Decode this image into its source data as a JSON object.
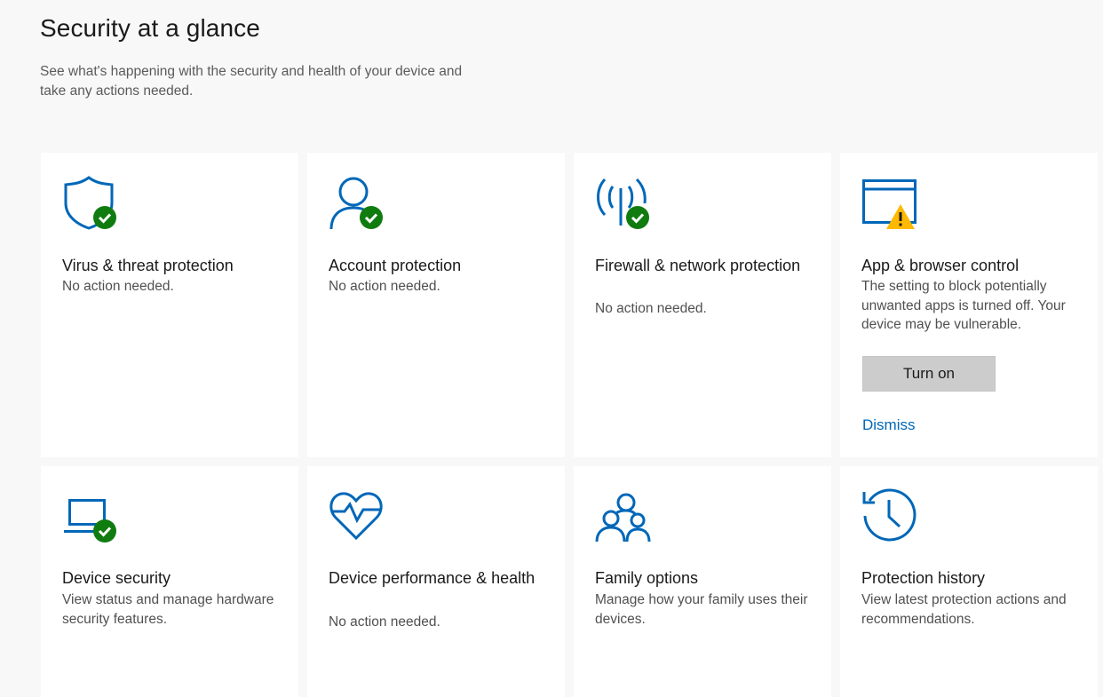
{
  "header": {
    "title": "Security at a glance",
    "subtitle": "See what's happening with the security and health of your device and take any actions needed."
  },
  "colors": {
    "accent": "#0067b8",
    "ok_badge": "#107c10",
    "warning_badge": "#ffb900",
    "card_bg": "#ffffff",
    "page_bg": "#f8f8f8"
  },
  "cards": [
    {
      "title": "Virus & threat protection",
      "description": "No action needed.",
      "icon": "shield-icon",
      "status": "ok"
    },
    {
      "title": "Account protection",
      "description": "No action needed.",
      "icon": "person-icon",
      "status": "ok"
    },
    {
      "title": "Firewall & network protection",
      "description": "No action needed.",
      "icon": "antenna-icon",
      "status": "ok"
    },
    {
      "title": "App & browser control",
      "description": "The setting to block potentially unwanted apps is turned off. Your device may be vulnerable.",
      "icon": "browser-window-icon",
      "status": "warning",
      "button_label": "Turn on",
      "link_label": "Dismiss"
    },
    {
      "title": "Device security",
      "description": "View status and manage hardware security features.",
      "icon": "laptop-icon",
      "status": "ok"
    },
    {
      "title": "Device performance & health",
      "description": "No action needed.",
      "icon": "heart-pulse-icon",
      "status": "none"
    },
    {
      "title": "Family options",
      "description": "Manage how your family uses their devices.",
      "icon": "family-icon",
      "status": "none"
    },
    {
      "title": "Protection history",
      "description": "View latest protection actions and recommendations.",
      "icon": "history-icon",
      "status": "none"
    }
  ]
}
